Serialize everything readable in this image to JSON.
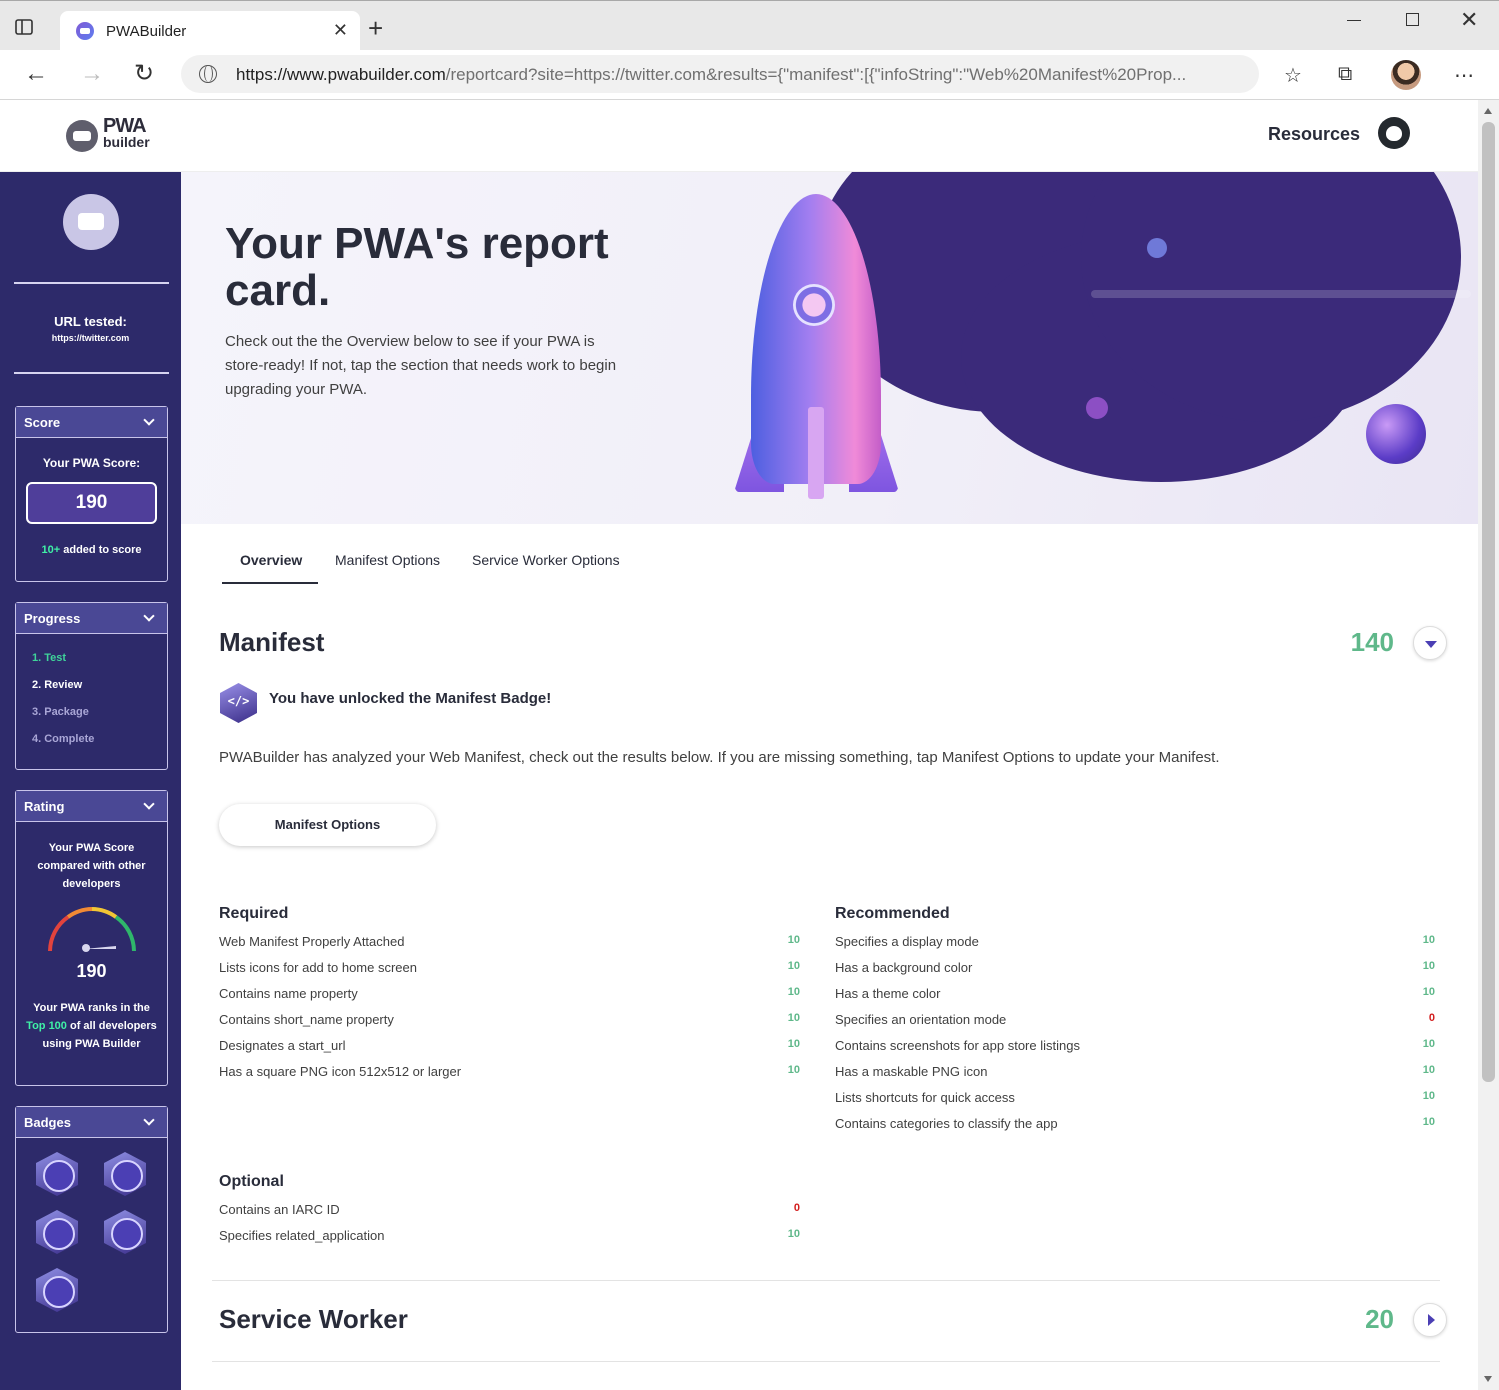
{
  "browser": {
    "tab_title": "PWABuilder",
    "url_host": "https://www.pwabuilder.com",
    "url_path": "/reportcard?site=https://twitter.com&results={\"manifest\":[{\"infoString\":\"Web%20Manifest%20Prop..."
  },
  "header": {
    "logo_line1": "PWA",
    "logo_line2": "builder",
    "resources_label": "Resources"
  },
  "sidebar": {
    "url_tested_label": "URL tested:",
    "url_tested": "https://twitter.com",
    "score_card": {
      "title": "Score",
      "label": "Your PWA Score:",
      "value": "190",
      "added_highlight": "10+",
      "added_text": " added to score"
    },
    "progress_card": {
      "title": "Progress",
      "steps": [
        "1. Test",
        "2. Review",
        "3. Package",
        "4. Complete"
      ]
    },
    "rating_card": {
      "title": "Rating",
      "caption": "Your PWA Score compared with other developers",
      "value": "190",
      "rank_pre": "Your PWA ranks in the ",
      "rank_highlight": "Top 100",
      "rank_post": " of all developers using PWA Builder"
    },
    "badges_card": {
      "title": "Badges"
    }
  },
  "hero": {
    "title": "Your PWA's report card.",
    "text": "Check out the the Overview below to see if your PWA is store-ready! If not, tap the section that needs work to begin upgrading your PWA."
  },
  "tabs": [
    "Overview",
    "Manifest Options",
    "Service Worker Options"
  ],
  "manifest": {
    "title": "Manifest",
    "score": "140",
    "badge_glyph": "</>",
    "unlock_text": "You have unlocked the Manifest Badge!",
    "analysis": "PWABuilder has analyzed your Web Manifest, check out the results below. If you are missing something, tap Manifest Options to update your Manifest.",
    "button_label": "Manifest Options",
    "required": {
      "title": "Required",
      "items": [
        {
          "label": "Web Manifest Properly Attached",
          "value": "10"
        },
        {
          "label": "Lists icons for add to home screen",
          "value": "10"
        },
        {
          "label": "Contains name property",
          "value": "10"
        },
        {
          "label": "Contains short_name property",
          "value": "10"
        },
        {
          "label": "Designates a start_url",
          "value": "10"
        },
        {
          "label": "Has a square PNG icon 512x512 or larger",
          "value": "10"
        }
      ]
    },
    "recommended": {
      "title": "Recommended",
      "items": [
        {
          "label": "Specifies a display mode",
          "value": "10"
        },
        {
          "label": "Has a background color",
          "value": "10"
        },
        {
          "label": "Has a theme color",
          "value": "10"
        },
        {
          "label": "Specifies an orientation mode",
          "value": "0"
        },
        {
          "label": "Contains screenshots for app store listings",
          "value": "10"
        },
        {
          "label": "Has a maskable PNG icon",
          "value": "10"
        },
        {
          "label": "Lists shortcuts for quick access",
          "value": "10"
        },
        {
          "label": "Contains categories to classify the app",
          "value": "10"
        }
      ]
    },
    "optional": {
      "title": "Optional",
      "items": [
        {
          "label": "Contains an IARC ID",
          "value": "0"
        },
        {
          "label": "Specifies related_application",
          "value": "10"
        }
      ]
    }
  },
  "service_worker": {
    "title": "Service Worker",
    "score": "20"
  },
  "colors": {
    "sidebar": "#2d2a6a",
    "score_green": "#5fb88a",
    "zero_red": "#d31e1e",
    "accent": "#4b3fb4"
  }
}
